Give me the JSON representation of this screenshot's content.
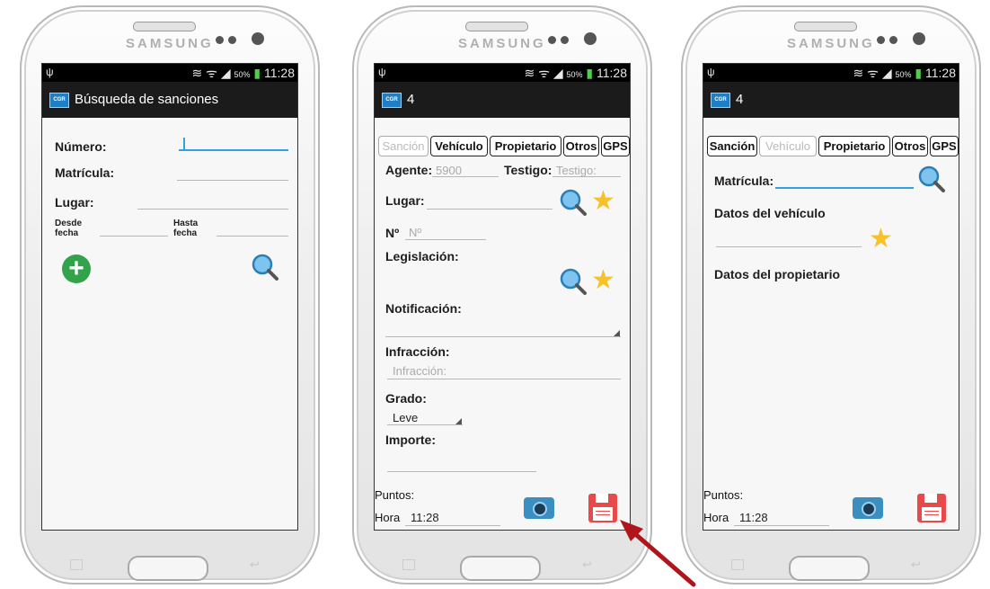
{
  "phones": {
    "brand": "SAMSUNG",
    "status": {
      "usb": "ψ",
      "icons": "≋ ᯤ ◢",
      "battery": "50%",
      "time": "11:28"
    }
  },
  "screen1": {
    "title": "Búsqueda de sanciones",
    "numero_label": "Número:",
    "matricula_label": "Matrícula:",
    "lugar_label": "Lugar:",
    "desde_label": "Desde fecha",
    "hasta_label": "Hasta fecha"
  },
  "screen2": {
    "title": "4",
    "tabs": [
      "Sanción",
      "Vehículo",
      "Propietario",
      "Otros",
      "GPS"
    ],
    "agente_label": "Agente:",
    "agente_value": "5900",
    "testigo_label": "Testigo:",
    "testigo_placeholder": "Testigo:",
    "lugar_label": "Lugar:",
    "num_label": "Nº",
    "num_placeholder": "Nº",
    "legislacion_label": "Legislación:",
    "notificacion_label": "Notificación:",
    "infraccion_label": "Infracción:",
    "infraccion_placeholder": "Infracción:",
    "grado_label": "Grado:",
    "grado_value": "Leve",
    "importe_label": "Importe:",
    "puntos_label": "Puntos:",
    "hora_label": "Hora",
    "hora_value": "11:28"
  },
  "screen3": {
    "title": "4",
    "matricula_label": "Matrícula:",
    "datos_vehiculo_label": "Datos del vehículo",
    "datos_propietario_label": "Datos del propietario",
    "puntos_label": "Puntos:",
    "hora_label": "Hora",
    "hora_value": "11:28"
  },
  "colors": {
    "accent": "#33a0e0",
    "save": "#e84a4a",
    "add": "#33a34b",
    "star": "#f8c12a",
    "arrow": "#b0151b"
  }
}
